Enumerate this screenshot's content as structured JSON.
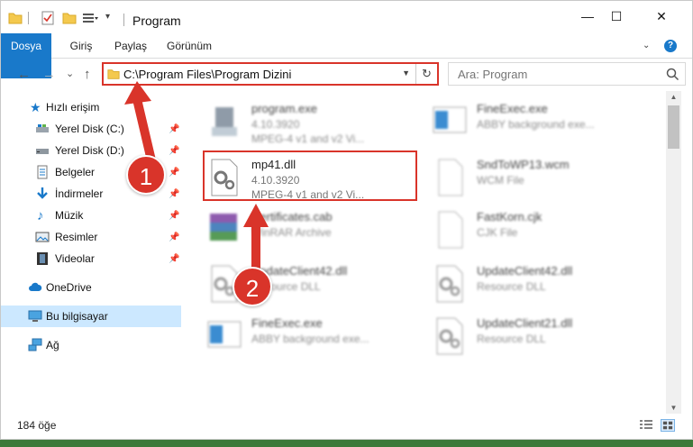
{
  "window": {
    "title": "Program",
    "controls": {
      "minimize": "—",
      "maximize": "☐",
      "close": "✕"
    }
  },
  "ribbon": {
    "tabs": [
      {
        "label": "Dosya"
      },
      {
        "label": "Giriş"
      },
      {
        "label": "Paylaş"
      },
      {
        "label": "Görünüm"
      }
    ],
    "help": "?"
  },
  "nav": {
    "back": "←",
    "forward": "→",
    "recent": "⌄",
    "up": "↑",
    "address": "C:\\Program Files\\Program Dizini",
    "refresh": "↻",
    "search_placeholder": "Ara: Program"
  },
  "sidebar": {
    "items": [
      {
        "label": "Hızlı erişim"
      },
      {
        "label": "Yerel Disk (C:)"
      },
      {
        "label": "Yerel Disk (D:)"
      },
      {
        "label": "Belgeler"
      },
      {
        "label": "İndirmeler"
      },
      {
        "label": "Müzik"
      },
      {
        "label": "Resimler"
      },
      {
        "label": "Videolar"
      },
      {
        "label": "OneDrive"
      },
      {
        "label": "Bu bilgisayar"
      },
      {
        "label": "Ağ"
      }
    ],
    "pin": "📌"
  },
  "files": [
    {
      "name": "program.exe",
      "line1": "4.10.3920",
      "line2": "MPEG-4 v1 and v2 Vi...",
      "icon": "exe-icon"
    },
    {
      "name": "FineExec.exe",
      "line1": "ABBY background exe...",
      "line2": "",
      "icon": "app-window-icon"
    },
    {
      "name": "mp41.dll",
      "line1": "4.10.3920",
      "line2": "MPEG-4 v1 and v2 Vi...",
      "icon": "dll-gear-icon"
    },
    {
      "name": "SndToWP13.wcm",
      "line1": "WCM File",
      "line2": "",
      "icon": "blank-file-icon"
    },
    {
      "name": "Certificates.cab",
      "line1": "WinRAR Archive",
      "line2": "",
      "icon": "winrar-icon"
    },
    {
      "name": "FastKorn.cjk",
      "line1": "CJK File",
      "line2": "",
      "icon": "blank-file-icon"
    },
    {
      "name": "UpdateClient42.dll",
      "line1": "Resource DLL",
      "line2": "",
      "icon": "dll-gear-icon"
    },
    {
      "name": "UpdateClient42.dll",
      "line1": "Resource DLL",
      "line2": "",
      "icon": "dll-gear-icon"
    },
    {
      "name": "FineExec.exe",
      "line1": "ABBY background exe...",
      "line2": "",
      "icon": "app-window-icon"
    },
    {
      "name": "UpdateClient21.dll",
      "line1": "Resource DLL",
      "line2": "",
      "icon": "dll-gear-icon"
    }
  ],
  "status": {
    "count": "184 öğe"
  },
  "annotations": {
    "step1": "1",
    "step2": "2"
  },
  "colors": {
    "accent": "#1979ca",
    "highlight": "#d9342a",
    "selected": "#cce8ff"
  }
}
